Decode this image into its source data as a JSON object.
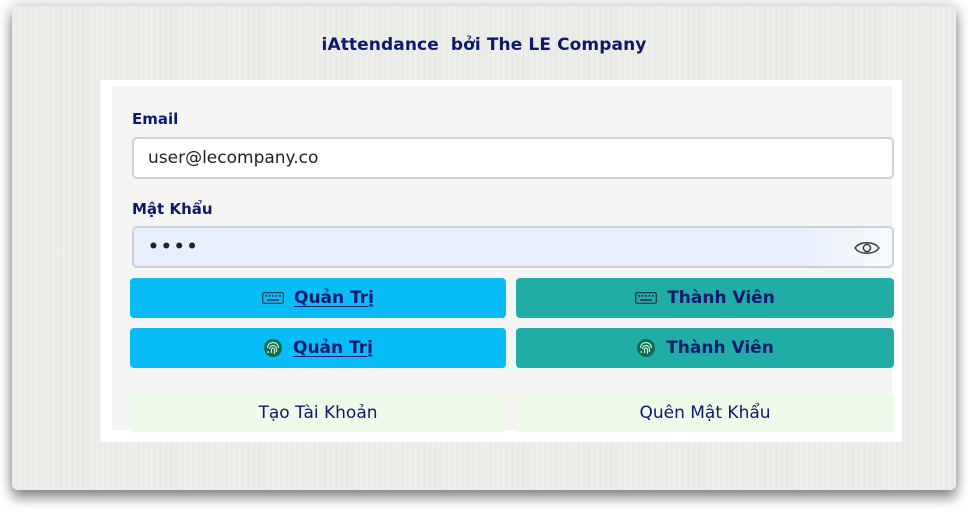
{
  "app": {
    "title": "iAttendance  bởi The LE Company"
  },
  "form": {
    "email_label": "Email",
    "email_value": "user@lecompany.co",
    "password_label": "Mật Khẩu",
    "password_value": "••••",
    "password_masked": true
  },
  "buttons": {
    "admin_keyboard_label": "Quản Trị",
    "member_keyboard_label": "Thành Viên",
    "admin_fingerprint_label": "Quản Trị",
    "member_fingerprint_label": "Thành Viên",
    "create_account_label": "Tạo Tài Khoản",
    "forgot_password_label": "Quên Mật Khẩu"
  },
  "icons": {
    "keyboard": "keyboard-icon",
    "fingerprint": "fingerprint-icon",
    "eye": "eye-icon"
  },
  "colors": {
    "primary_text": "#0b1a6e",
    "admin_button": "#08bdf7",
    "member_button": "#20ada6",
    "secondary_button": "#eefbe9",
    "password_fill": "#e8f0fd"
  }
}
